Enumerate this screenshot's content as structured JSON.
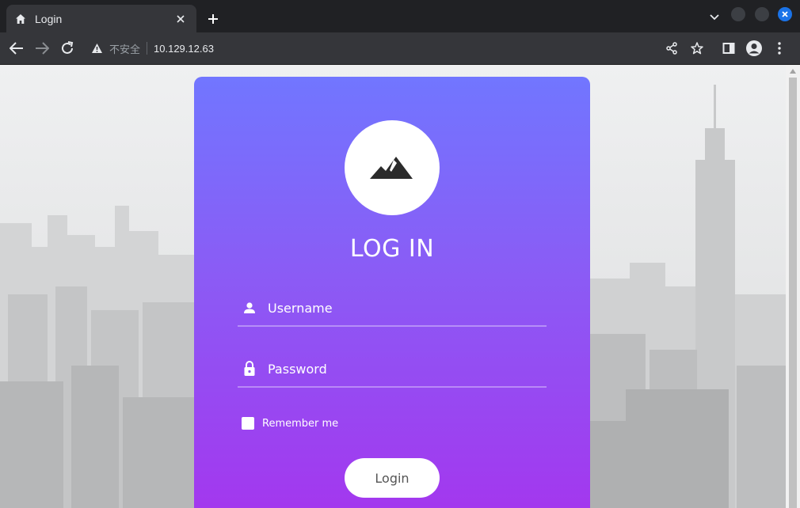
{
  "browser": {
    "tab": {
      "title": "Login",
      "favicon": "home-icon"
    },
    "address": {
      "security_label": "不安全",
      "url": "10.129.12.63"
    }
  },
  "login": {
    "title": "LOG IN",
    "username_placeholder": "Username",
    "password_placeholder": "Password",
    "remember_label": "Remember me",
    "submit_label": "Login"
  },
  "colors": {
    "card_gradient_top": "#7176ff",
    "card_gradient_bottom": "#a436ee",
    "browser_dark": "#202124",
    "toolbar": "#35363a",
    "close_button": "#1a73e8"
  }
}
